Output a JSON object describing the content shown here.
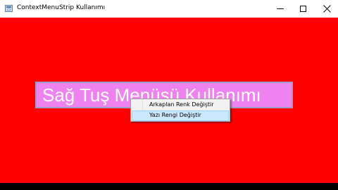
{
  "window": {
    "title": "ContextMenuStrip Kullanımı"
  },
  "form": {
    "background_color": "#ff0000"
  },
  "label": {
    "text": "Sağ Tuş Menüsü Kullanımı",
    "background_color": "#ee82ee",
    "text_color": "#ffffff"
  },
  "context_menu": {
    "items": [
      {
        "label": "Arkaplan Renk Değiştir",
        "highlighted": false
      },
      {
        "label": "Yazı Rengi Değiştir",
        "highlighted": true
      }
    ]
  },
  "icons": {
    "app": "form-icon",
    "minimize": "minimize-icon",
    "maximize": "maximize-icon",
    "close": "close-icon"
  }
}
